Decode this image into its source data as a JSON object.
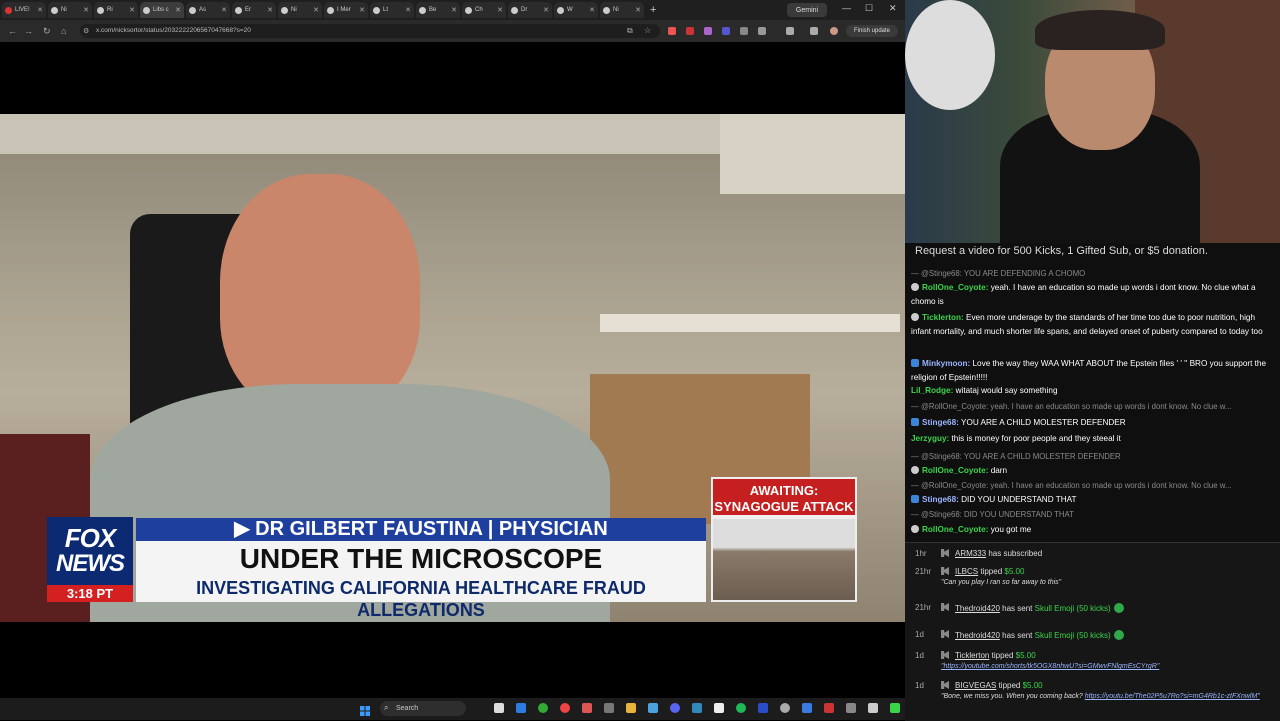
{
  "browser": {
    "tabs": [
      {
        "label": "LIVE!",
        "red": true
      },
      {
        "label": "Ni"
      },
      {
        "label": "Ri"
      },
      {
        "label": "Libs c",
        "active": true
      },
      {
        "label": "As"
      },
      {
        "label": "Er"
      },
      {
        "label": "Ni"
      },
      {
        "label": "I Mer"
      },
      {
        "label": "Lt"
      },
      {
        "label": "Be"
      },
      {
        "label": "Ch"
      },
      {
        "label": "Dr"
      },
      {
        "label": "W"
      },
      {
        "label": "Ni"
      }
    ],
    "gemini_label": "Gemini",
    "url": "x.com/nicksortor/status/2032222206567047668?s=20",
    "finish_update": "Finish update"
  },
  "video": {
    "fox_line1": "FOX",
    "fox_line2": "NEWS",
    "time": "3:18 PT",
    "name_line": "▶ DR GILBERT FAUSTINA | PHYSICIAN",
    "headline": "UNDER THE MICROSCOPE",
    "subheadline": "INVESTIGATING CALIFORNIA HEALTHCARE FRAUD ALLEGATIONS",
    "inset_title": "AWAITING: SYNAGOGUE ATTACK NEWS CONFERENCE"
  },
  "taskbar": {
    "search_placeholder": "Search"
  },
  "chat": {
    "promo": "Request a video for 500 Kicks, 1 Gifted Sub, or $5 donation.",
    "messages": [
      {
        "reply": "— @Stinge68: YOU ARE DEFENDING A CHOMO"
      },
      {
        "user": "RollOne_Coyote:",
        "text": " yeah. I have an education so made up words i dont know. No clue what a chomo is",
        "color": "g"
      },
      {
        "user": "Ticklerton:",
        "text": " Even more underage by the standards of her time too due to poor nutrition, high infant mortality, and much shorter life spans, and delayed onset of puberty compared to today too",
        "color": "g"
      },
      {
        "user": "Minkymoon:",
        "text": " Love the way they WAA WHAT ABOUT the Epstein files ' ' '' BRO you support the religion of Epstein!!!!!",
        "color": "c"
      },
      {
        "user": "Lil_Rodge:",
        "text": " witataj would say something",
        "color": "g"
      },
      {
        "reply": "— @RollOne_Coyote: yeah. I have an education so made up words i dont know. No clue w..."
      },
      {
        "user": "Stinge68:",
        "text": " YOU ARE A CHILD MOLESTER DEFENDER",
        "color": "c"
      },
      {
        "user": "Jerzyguy:",
        "text": " this is money for poor people and they steeal it",
        "color": "g"
      },
      {
        "reply": "— @Stinge68: YOU ARE A CHILD MOLESTER DEFENDER"
      },
      {
        "user": "RollOne_Coyote:",
        "text": " darn",
        "color": "g"
      },
      {
        "reply": "— @RollOne_Coyote: yeah. I have an education so made up words i dont know. No clue w..."
      },
      {
        "user": "Stinge68:",
        "text": " DID YOU UNDERSTAND THAT",
        "color": "c"
      },
      {
        "reply": "— @Stinge68: DID YOU UNDERSTAND THAT"
      },
      {
        "user": "RollOne_Coyote:",
        "text": " you got me",
        "color": "g"
      }
    ],
    "events": [
      {
        "time": "1hr",
        "user": "ARM333",
        "action": " has subscribed"
      },
      {
        "time": "21hr",
        "user": "ILBCS",
        "action": " tipped ",
        "amount": "$5.00",
        "note": "\"Can you play I ran so far away to this\""
      },
      {
        "time": "21hr",
        "user": "Thedroid420",
        "action": " has sent ",
        "item": "Skull Emoji (50 kicks)"
      },
      {
        "time": "1d",
        "user": "Thedroid420",
        "action": " has sent ",
        "item": "Skull Emoji (50 kicks)"
      },
      {
        "time": "1d",
        "user": "Ticklerton",
        "action": " tipped ",
        "amount": "$5.00",
        "link": "\"https://youtube.com/shorts/tk5OGX8nhwU?si=GMwvFNlgmEsCYrgR\""
      },
      {
        "time": "1d",
        "user": "BIGVEGAS",
        "action": " tipped ",
        "amount": "$5.00",
        "note": "\"Bone, we miss you. When you coming back? ",
        "link": "https://youtu.be/The02P5u7Ro?si=mG4Rb1c-ztFXnwlM\""
      }
    ]
  }
}
